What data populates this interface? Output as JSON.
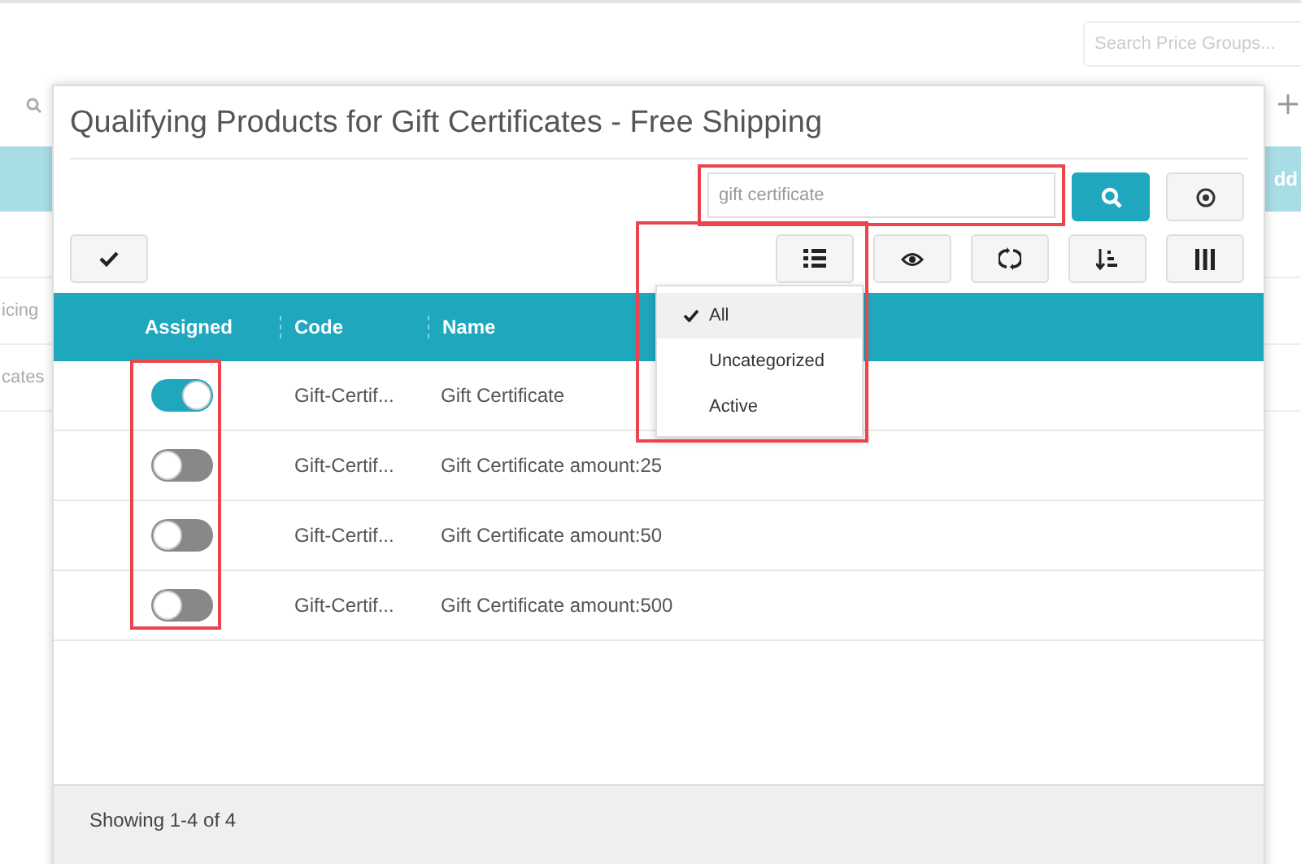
{
  "background": {
    "search": {
      "placeholder": "Search Price Groups..."
    },
    "button_fragment": "dd",
    "row_fragments": [
      "icing",
      "cates"
    ]
  },
  "dialog": {
    "title": "Qualifying Products for Gift Certificates - Free Shipping",
    "search": {
      "value": "gift certificate"
    },
    "filter_menu": [
      {
        "label": "All",
        "selected": true
      },
      {
        "label": "Uncategorized",
        "selected": false
      },
      {
        "label": "Active",
        "selected": false
      }
    ],
    "table": {
      "columns": [
        "Assigned",
        "Code",
        "Name"
      ],
      "rows": [
        {
          "assigned": true,
          "code": "Gift-Certif...",
          "name": "Gift Certificate"
        },
        {
          "assigned": false,
          "code": "Gift-Certif...",
          "name": "Gift Certificate amount:25"
        },
        {
          "assigned": false,
          "code": "Gift-Certif...",
          "name": "Gift Certificate amount:50"
        },
        {
          "assigned": false,
          "code": "Gift-Certif...",
          "name": "Gift Certificate amount:500"
        }
      ]
    },
    "footer": "Showing 1-4 of 4"
  }
}
